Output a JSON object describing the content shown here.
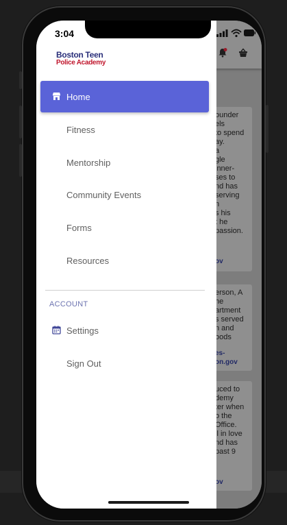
{
  "status_bar": {
    "time": "3:04"
  },
  "logo": {
    "line1": "Boston Teen",
    "line2": "Police Academy"
  },
  "drawer": {
    "nav_items": [
      {
        "label": "Home",
        "icon": "store-icon",
        "active": true
      },
      {
        "label": "Fitness"
      },
      {
        "label": "Mentorship"
      },
      {
        "label": "Community Events"
      },
      {
        "label": "Forms"
      },
      {
        "label": "Resources"
      }
    ],
    "account_section": {
      "title": "ACCOUNT",
      "items": [
        {
          "label": "Settings",
          "icon": "calendar-icon"
        },
        {
          "label": "Sign Out"
        }
      ]
    }
  },
  "background_cards": [
    {
      "text": "ounder\nels\nto spend\nay.\na\ngle\ninner-\nses to\nnd has\n serving\nn\ns his\nt he\npassion.",
      "link": "ov"
    },
    {
      "text": "erson, A\nhe\nartment\ns served\nn and\noods",
      "link": "es-\non.gov"
    },
    {
      "text": "uced to\ndemy\nter when\no the\n Office.\nll in love\nnd has\npast 9",
      "link": "ov"
    }
  ],
  "colors": {
    "accent": "#5a63d8",
    "logo_blue": "#2a2f7a",
    "logo_red": "#c0162c",
    "section_label": "#6c73b0"
  }
}
